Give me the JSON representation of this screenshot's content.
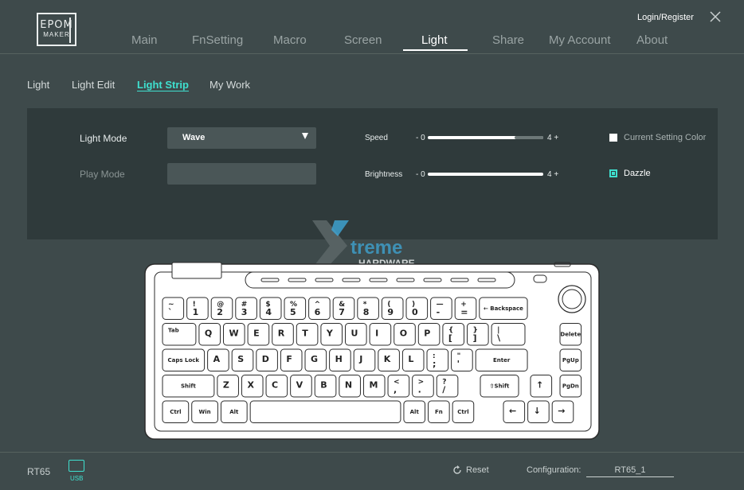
{
  "brand": {
    "line1": "EPOM",
    "line2": "MAKER"
  },
  "header": {
    "login_label": "Login/Register"
  },
  "nav": {
    "items": [
      {
        "label": "Main"
      },
      {
        "label": "FnSetting"
      },
      {
        "label": "Macro"
      },
      {
        "label": "Screen"
      },
      {
        "label": "Light"
      },
      {
        "label": "Share"
      },
      {
        "label": "My Account"
      },
      {
        "label": "About"
      }
    ],
    "active": "Light"
  },
  "subtabs": {
    "items": [
      {
        "label": "Light"
      },
      {
        "label": "Light Edit"
      },
      {
        "label": "Light Strip"
      },
      {
        "label": "My Work"
      }
    ],
    "active": "Light Strip"
  },
  "settings": {
    "light_mode_label": "Light Mode",
    "light_mode_value": "Wave",
    "play_mode_label": "Play Mode",
    "play_mode_value": "",
    "speed": {
      "label": "Speed",
      "min_label": "- 0",
      "max_label": "4 +",
      "level": 0.75
    },
    "brightness": {
      "label": "Brightness",
      "min_label": "- 0",
      "max_label": "4 +",
      "level": 1.0
    },
    "current_setting_color": {
      "label": "Current Setting Color",
      "checked": false
    },
    "dazzle": {
      "label": "Dazzle",
      "checked": true
    }
  },
  "watermark": {
    "line1": "treme",
    "line2": "HARDWARE"
  },
  "keyboard": {
    "rows": [
      [
        [
          "~",
          "`"
        ],
        [
          "!",
          "1"
        ],
        [
          "@",
          "2"
        ],
        [
          "#",
          "3"
        ],
        [
          "$",
          "4"
        ],
        [
          "%",
          "5"
        ],
        [
          "^",
          "6"
        ],
        [
          "&",
          "7"
        ],
        [
          "*",
          "8"
        ],
        [
          "(",
          "9"
        ],
        [
          ")",
          "0"
        ],
        [
          "—",
          "-"
        ],
        [
          "+",
          "="
        ],
        [
          "",
          "← Backspace"
        ]
      ],
      [
        [
          "Tab",
          ""
        ],
        [
          "",
          "Q"
        ],
        [
          "",
          "W"
        ],
        [
          "",
          "E"
        ],
        [
          "",
          "R"
        ],
        [
          "",
          "T"
        ],
        [
          "",
          "Y"
        ],
        [
          "",
          "U"
        ],
        [
          "",
          "I"
        ],
        [
          "",
          "O"
        ],
        [
          "",
          "P"
        ],
        [
          "{",
          "["
        ],
        [
          "}",
          "]"
        ],
        [
          "|",
          "\\"
        ],
        [
          "",
          "Delete"
        ]
      ],
      [
        [
          "",
          "Caps Lock"
        ],
        [
          "",
          "A"
        ],
        [
          "",
          "S"
        ],
        [
          "",
          "D"
        ],
        [
          "",
          "F"
        ],
        [
          "",
          "G"
        ],
        [
          "",
          "H"
        ],
        [
          "",
          "J"
        ],
        [
          "",
          "K"
        ],
        [
          "",
          "L"
        ],
        [
          ":",
          ";"
        ],
        [
          "\"",
          "'"
        ],
        [
          "",
          "Enter"
        ],
        [
          "",
          "PgUp"
        ]
      ],
      [
        [
          "",
          "Shift"
        ],
        [
          "",
          "Z"
        ],
        [
          "",
          "X"
        ],
        [
          "",
          "C"
        ],
        [
          "",
          "V"
        ],
        [
          "",
          "B"
        ],
        [
          "",
          "N"
        ],
        [
          "",
          "M"
        ],
        [
          "<",
          ","
        ],
        [
          ">",
          "."
        ],
        [
          "?",
          "/"
        ],
        [
          "",
          "⇧Shift"
        ],
        [
          "",
          "↑"
        ],
        [
          "",
          "PgDn"
        ]
      ],
      [
        [
          "",
          "Ctrl"
        ],
        [
          "",
          "Win"
        ],
        [
          "",
          "Alt"
        ],
        [
          "",
          ""
        ],
        [
          "",
          "Alt"
        ],
        [
          "",
          "Fn"
        ],
        [
          "",
          "Ctrl"
        ],
        [
          "",
          "←"
        ],
        [
          "",
          "↓"
        ],
        [
          "",
          "→"
        ]
      ]
    ]
  },
  "footer": {
    "model": "RT65",
    "usb_label": "USB",
    "reset_label": "Reset",
    "configuration_label": "Configuration:",
    "configuration_value": "RT65_1"
  },
  "colors": {
    "accent": "#3fe0cf",
    "background": "#3e4a4b",
    "panel": "#2f3a3b"
  }
}
